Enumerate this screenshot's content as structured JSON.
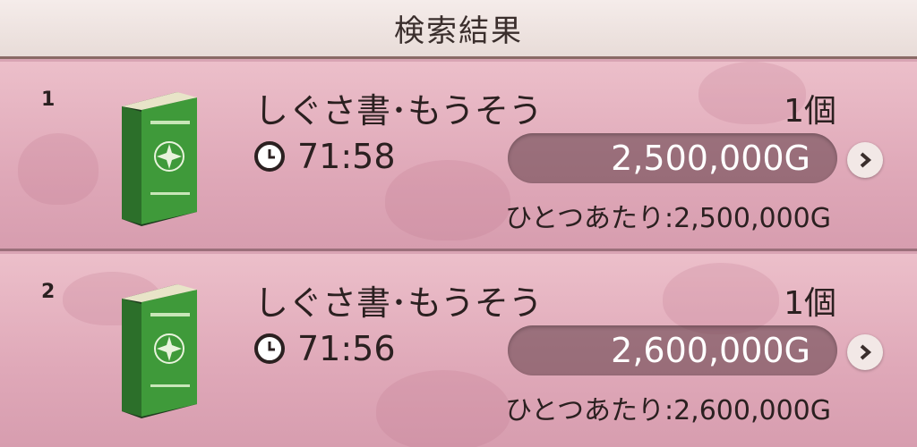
{
  "header": {
    "title": "検索結果"
  },
  "results": [
    {
      "index": "1",
      "item_name": "しぐさ書･もうそう",
      "quantity": "1個",
      "time_left": "71:58",
      "price": "2,500,000G",
      "unit_price": "ひとつあたり:2,500,000G"
    },
    {
      "index": "2",
      "item_name": "しぐさ書･もうそう",
      "quantity": "1個",
      "time_left": "71:56",
      "price": "2,600,000G",
      "unit_price": "ひとつあたり:2,600,000G"
    }
  ],
  "icons": {
    "book": "green-book-icon",
    "clock": "clock-icon",
    "arrow": "chevron-right-icon"
  },
  "colors": {
    "book_green": "#2f7a2f",
    "header_bg": "#f5ecea",
    "row_bg": "#e2adbd"
  }
}
